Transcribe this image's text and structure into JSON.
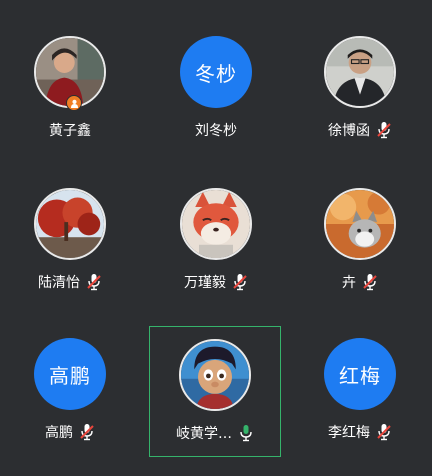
{
  "participants": [
    {
      "name": "黄子鑫",
      "avatar_type": "photo",
      "avatar_icon": "person-photo-icon",
      "is_host": true,
      "mic": "none"
    },
    {
      "name": "刘冬杪",
      "avatar_type": "text",
      "avatar_text": "冬杪",
      "mic": "none"
    },
    {
      "name": "徐博函",
      "avatar_type": "photo",
      "avatar_icon": "person-photo-icon",
      "mic": "muted"
    },
    {
      "name": "陆清怡",
      "avatar_type": "photo",
      "avatar_icon": "autumn-tree-photo-icon",
      "mic": "muted"
    },
    {
      "name": "万瑾毅",
      "avatar_type": "photo",
      "avatar_icon": "cartoon-fox-icon",
      "mic": "muted"
    },
    {
      "name": "卉",
      "avatar_type": "photo",
      "avatar_icon": "cat-photo-icon",
      "mic": "muted"
    },
    {
      "name": "高鹏",
      "avatar_type": "text",
      "avatar_text": "高鹏",
      "mic": "muted"
    },
    {
      "name": "岐黄学…",
      "avatar_type": "photo",
      "avatar_icon": "cartoon-boy-icon",
      "mic": "speaking",
      "active": true
    },
    {
      "name": "李红梅",
      "avatar_type": "text",
      "avatar_text": "红梅",
      "mic": "muted"
    }
  ],
  "colors": {
    "background": "#2c2e31",
    "text_avatar": "#1e7cf2",
    "muted_slash": "#e8453c",
    "speaking_mic": "#35b36b",
    "active_border": "#35b36b",
    "host_badge": "#f07e25"
  }
}
